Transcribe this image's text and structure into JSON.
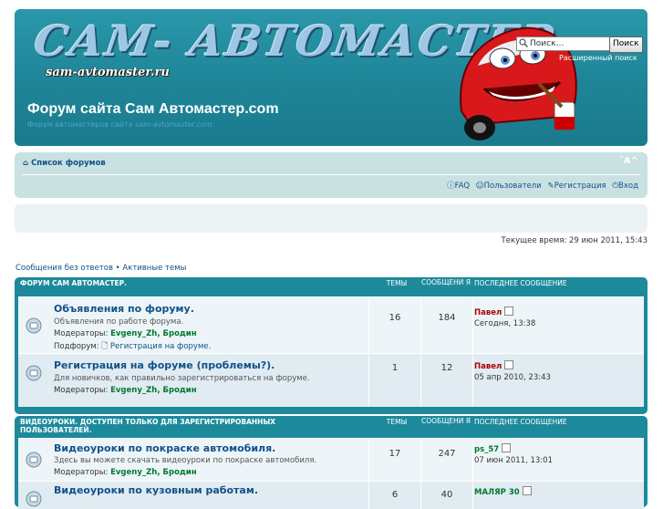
{
  "header": {
    "logo_text": "САМ- АВТОМАСТЕР",
    "logo_sub": "sam-avtomaster.ru",
    "site_title": "Форум сайта Сам Автомастер.com",
    "site_desc": "Форум автомастеров сайта sam-avtomaster.com",
    "search_placeholder": "Поиск…",
    "search_button": "Поиск",
    "advanced_search": "Расширенный поиск"
  },
  "navbar": {
    "home": "Список форумов",
    "font_ctrl": "ˇA^",
    "faq": "FAQ",
    "users": "Пользователи",
    "register": "Регистрация",
    "login": "Вход"
  },
  "current_time": "Текущее время: 29 июн 2011, 15:43",
  "quick_links": "Сообщения без ответов • Активные темы",
  "columns": {
    "topics": "Темы",
    "posts": "Сообщени я",
    "last": "Последнее сообщение"
  },
  "categories": [
    {
      "title": "Форум Сам Автомастер.",
      "forums": [
        {
          "title": "Объявления по форуму.",
          "desc": "Объявления по работе форума.",
          "mods_label": "Модераторы: ",
          "mods": "Evgeny_Zh, Бродин",
          "sub_label": "Подфорум: ",
          "sub": "Регистрация на форуме.",
          "topics": "16",
          "posts": "184",
          "last_user": "Павел",
          "last_time": "Сегодня, 13:38"
        },
        {
          "title": "Регистрация на форуме (проблемы?).",
          "desc": "Для новичков, как правильно зарегистрироваться на форуме.",
          "mods_label": "Модераторы: ",
          "mods": "Evgeny_Zh, Бродин",
          "topics": "1",
          "posts": "12",
          "last_user": "Павел",
          "last_time": "05 апр 2010, 23:43"
        }
      ]
    },
    {
      "title": "Видеоуроки. Доступен только для зарегистрированных пользователей.",
      "forums": [
        {
          "title": "Видеоуроки по покраске автомобиля.",
          "desc": "Здесь вы можете скачать видеоуроки по покраске автомобиля.",
          "mods_label": "Модераторы: ",
          "mods": "Evgeny_Zh, Бродин",
          "topics": "17",
          "posts": "247",
          "last_user": "ps_57",
          "last_time": "07 июн 2011, 13:01"
        },
        {
          "title": "Видеоуроки по кузовным работам.",
          "topics": "6",
          "posts": "40",
          "last_user": "МАЛЯР 30"
        }
      ]
    }
  ],
  "colors": {
    "header_bg": "#1e8497",
    "navbar_bg": "#cae1e2",
    "link": "#105289",
    "moderator": "#00792e",
    "last_user": "#aa0000"
  }
}
